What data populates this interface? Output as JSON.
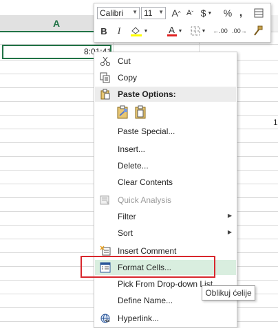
{
  "sheet": {
    "column_header": "A",
    "selected_cell_value": "8:01:41",
    "edge_text": "1"
  },
  "mini_toolbar": {
    "font_name": "Calibri",
    "font_size": "11",
    "increase_font_glyph": "A",
    "decrease_font_glyph": "A",
    "currency_glyph": "$",
    "percent_glyph": "%",
    "comma_glyph": ",",
    "bold_glyph": "B",
    "italic_glyph": "I",
    "font_color_glyph": "A",
    "increase_decimal_glyph": ".00",
    "decrease_decimal_glyph": ".00",
    "highlight_color": "#ffff00",
    "font_color": "#e02020"
  },
  "context_menu": {
    "items": [
      {
        "label": "Cut",
        "icon": "scissors-icon"
      },
      {
        "label": "Copy",
        "icon": "copy-icon"
      },
      {
        "label": "Paste Options:",
        "icon": "paste-icon"
      },
      {
        "label": "Paste Special...",
        "icon": ""
      },
      {
        "label": "Insert...",
        "icon": ""
      },
      {
        "label": "Delete...",
        "icon": ""
      },
      {
        "label": "Clear Contents",
        "icon": ""
      },
      {
        "label": "Quick Analysis",
        "icon": "quick-analysis-icon",
        "disabled": true
      },
      {
        "label": "Filter",
        "icon": "",
        "submenu": true
      },
      {
        "label": "Sort",
        "icon": "",
        "submenu": true
      },
      {
        "label": "Insert Comment",
        "icon": "insert-comment-icon"
      },
      {
        "label": "Format Cells...",
        "icon": "format-cells-icon",
        "highlighted": true
      },
      {
        "label": "Pick From Drop-down List...",
        "icon": ""
      },
      {
        "label": "Define Name...",
        "icon": ""
      },
      {
        "label": "Hyperlink...",
        "icon": "hyperlink-icon"
      }
    ]
  },
  "tooltip": {
    "text": "Oblikuj ćelije"
  },
  "colors": {
    "excel_green": "#217346",
    "highlight_bg": "#d9eedf",
    "red_outline": "#d8262c"
  }
}
